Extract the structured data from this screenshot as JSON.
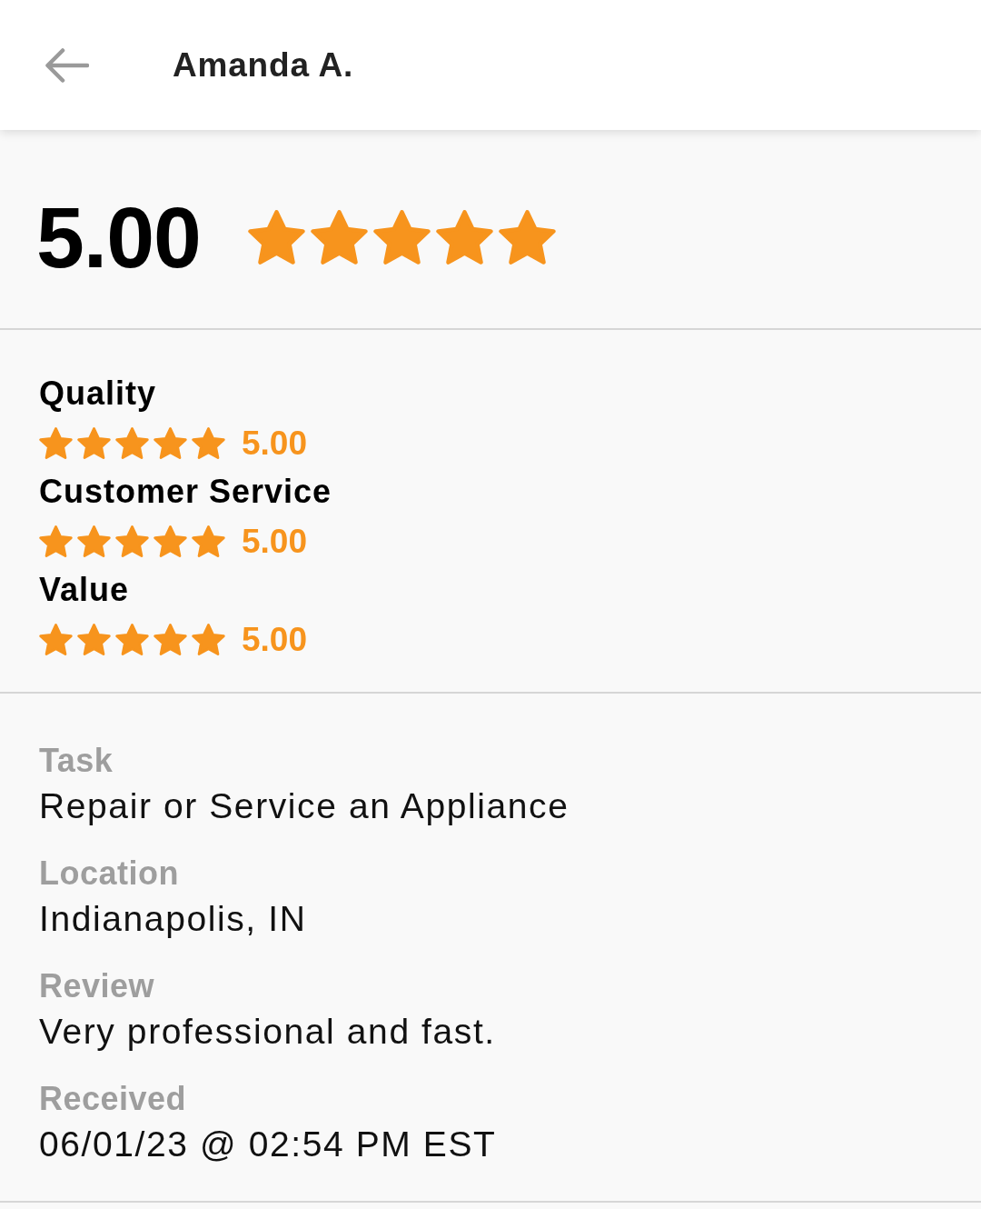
{
  "header": {
    "title": "Amanda A."
  },
  "overall": {
    "rating": "5.00",
    "stars": 5
  },
  "categories": [
    {
      "name": "Quality",
      "stars": 5,
      "rating": "5.00"
    },
    {
      "name": "Customer Service",
      "stars": 5,
      "rating": "5.00"
    },
    {
      "name": "Value",
      "stars": 5,
      "rating": "5.00"
    }
  ],
  "details": [
    {
      "label": "Task",
      "value": "Repair or Service an Appliance"
    },
    {
      "label": "Location",
      "value": "Indianapolis, IN"
    },
    {
      "label": "Review",
      "value": "Very professional and fast."
    },
    {
      "label": "Received",
      "value": "06/01/23 @ 02:54 PM EST"
    }
  ]
}
